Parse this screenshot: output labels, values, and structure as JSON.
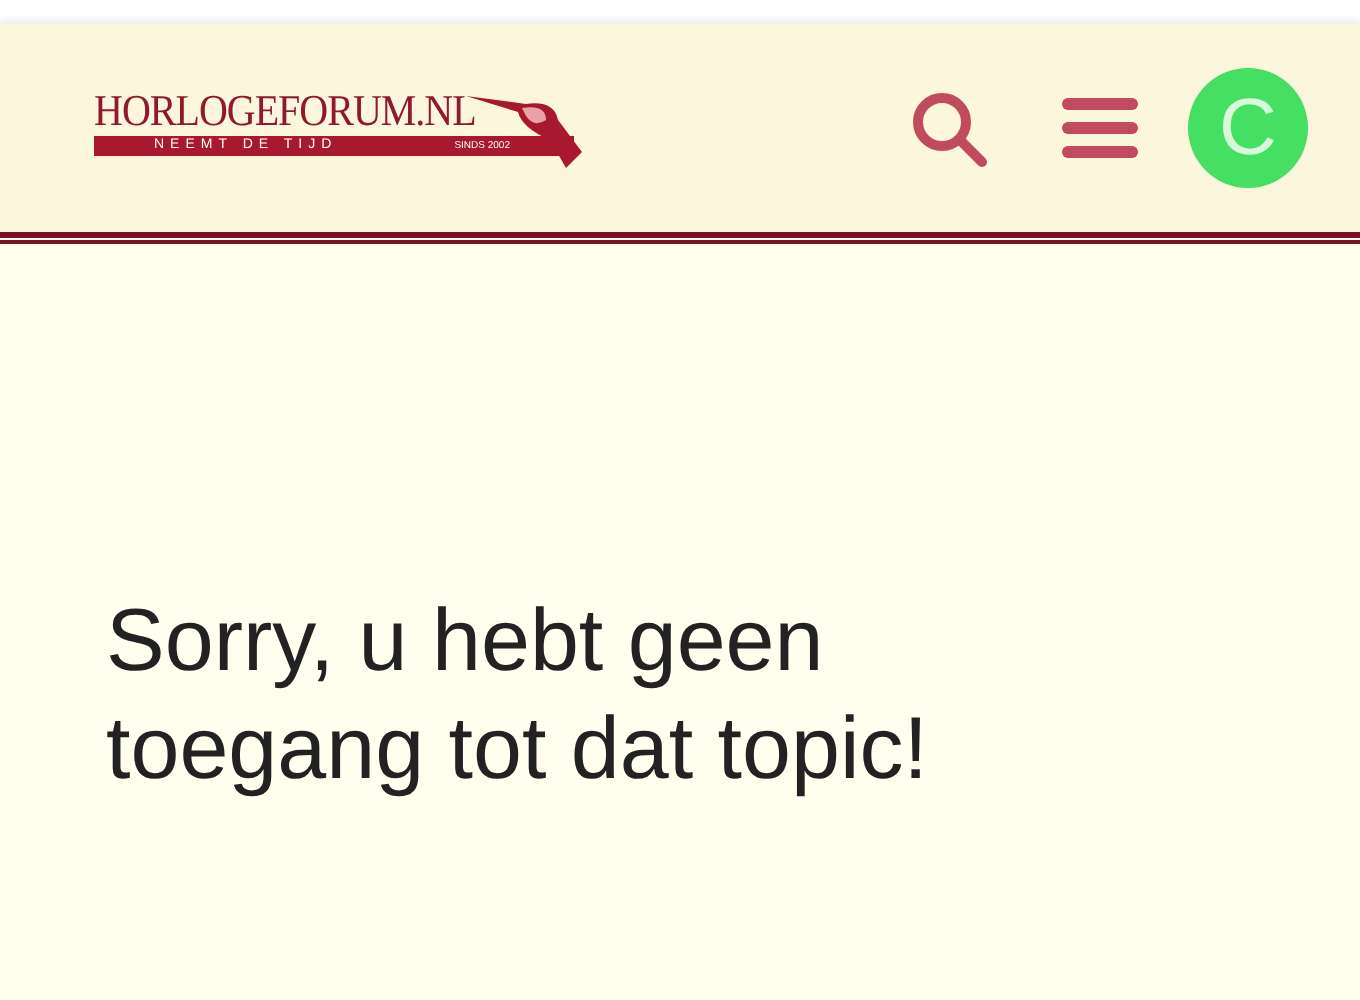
{
  "header": {
    "logo": {
      "name": "HORLOGEFORUM.NL",
      "tagline": "NEEMT DE TIJD",
      "since": "SINDS 2002"
    },
    "avatar": {
      "letter": "C",
      "color": "#45e063"
    }
  },
  "message": "Sorry, u hebt geen toegang tot dat topic!"
}
